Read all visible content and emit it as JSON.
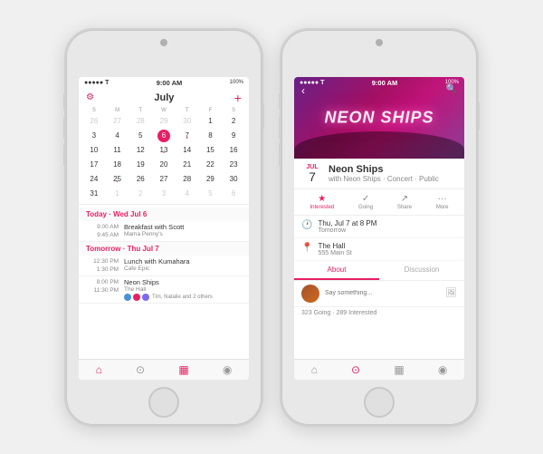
{
  "background": "#f0f0f0",
  "phone1": {
    "status": {
      "left": "●●●●● T",
      "time": "9:00 AM",
      "right": "100%"
    },
    "calendar": {
      "month": "July",
      "days_header": [
        "S",
        "M",
        "T",
        "W",
        "T",
        "F",
        "S"
      ],
      "weeks": [
        [
          {
            "label": "26",
            "other": true
          },
          {
            "label": "27",
            "other": true
          },
          {
            "label": "28",
            "other": true
          },
          {
            "label": "29",
            "other": true
          },
          {
            "label": "30",
            "other": true
          },
          {
            "label": "1",
            "dot": false
          },
          {
            "label": "2",
            "dot": false
          }
        ],
        [
          {
            "label": "3",
            "dot": false
          },
          {
            "label": "4",
            "dot": false
          },
          {
            "label": "5",
            "dot": false
          },
          {
            "label": "6",
            "today": true
          },
          {
            "label": "7",
            "dot": true
          },
          {
            "label": "8",
            "dot": false
          },
          {
            "label": "9",
            "dot": false
          }
        ],
        [
          {
            "label": "10",
            "dot": false
          },
          {
            "label": "11",
            "dot": false
          },
          {
            "label": "12",
            "dot": false
          },
          {
            "label": "13",
            "dot": true
          },
          {
            "label": "14",
            "dot": false
          },
          {
            "label": "15",
            "dot": false
          },
          {
            "label": "16",
            "dot": false
          }
        ],
        [
          {
            "label": "17",
            "dot": false
          },
          {
            "label": "18",
            "dot": false
          },
          {
            "label": "19",
            "dot": false
          },
          {
            "label": "20",
            "dot": false
          },
          {
            "label": "21",
            "dot": false
          },
          {
            "label": "22",
            "dot": false
          },
          {
            "label": "23",
            "dot": false
          }
        ],
        [
          {
            "label": "24",
            "dot": false
          },
          {
            "label": "25",
            "dot": true
          },
          {
            "label": "26",
            "dot": false
          },
          {
            "label": "27",
            "dot": false
          },
          {
            "label": "28",
            "dot": false
          },
          {
            "label": "29",
            "dot": false
          },
          {
            "label": "30",
            "dot": false
          }
        ],
        [
          {
            "label": "31",
            "dot": false
          },
          {
            "label": "1",
            "other": true
          },
          {
            "label": "2",
            "other": true
          },
          {
            "label": "3",
            "other": true
          },
          {
            "label": "4",
            "other": true
          },
          {
            "label": "5",
            "other": true
          },
          {
            "label": "6",
            "other": true
          }
        ]
      ],
      "today_section": "Today · Wed Jul 6",
      "events_today": [
        {
          "time1": "9:00 AM",
          "time2": "9:45 AM",
          "title": "Breakfast with Scott",
          "subtitle": "Mama Penny's"
        },
        {
          "time1": "",
          "time2": "",
          "title": "",
          "subtitle": ""
        }
      ],
      "tomorrow_section": "Tomorrow · Thu Jul 7",
      "events_tomorrow": [
        {
          "time1": "12:30 PM",
          "time2": "1:30 PM",
          "title": "Lunch with Kumahara",
          "subtitle": "Cafe Epic"
        },
        {
          "time1": "8:00 PM",
          "time2": "11:30 PM",
          "title": "Neon Ships",
          "subtitle": "The Hall",
          "has_avatars": true
        }
      ]
    },
    "bottom_bar": [
      "⌂",
      "🔍",
      "📅",
      "👤"
    ]
  },
  "phone2": {
    "status": {
      "left": "●●●●● T",
      "time": "9:00 AM",
      "right": "100%"
    },
    "event": {
      "hero_text": "NEON SHIPS",
      "date_month": "JUL",
      "date_day": "7",
      "title": "Neon Ships",
      "subtitle": "with Neon Ships · Concert · Public",
      "actions": [
        {
          "icon": "★",
          "label": "Interested",
          "active": true
        },
        {
          "icon": "✓",
          "label": "Going",
          "active": false
        },
        {
          "icon": "↗",
          "label": "Share",
          "active": false
        },
        {
          "icon": "•••",
          "label": "More",
          "active": false
        }
      ],
      "details": [
        {
          "icon": "🕐",
          "main": "Thu, Jul 7 at 8 PM",
          "sub": "Tomorrow"
        },
        {
          "icon": "📍",
          "main": "The Hall",
          "sub": "555 Main St"
        }
      ],
      "tabs": [
        "About",
        "Discussion"
      ],
      "active_tab": "About",
      "comment_placeholder": "Say something...",
      "going_info": "323 Going · 289 Interested"
    },
    "bottom_bar": [
      "⌂",
      "🔍",
      "📅",
      "👤"
    ]
  }
}
